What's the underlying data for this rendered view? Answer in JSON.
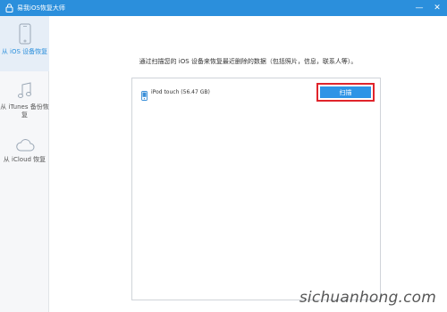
{
  "window": {
    "title": "易我iOS恢复大师",
    "controls": {
      "minimize": "—",
      "close": "✕"
    }
  },
  "sidebar": {
    "items": [
      {
        "label": "从 iOS 设备恢复",
        "icon": "phone-icon",
        "active": true
      },
      {
        "label": "从 iTunes 备份恢复",
        "icon": "music-note-icon",
        "active": false
      },
      {
        "label": "从 iCloud 恢复",
        "icon": "cloud-icon",
        "active": false
      }
    ]
  },
  "main": {
    "instruction": "通过扫描您的 iOS 设备来恢复最近删除的数据（包括照片，信息，联系人等）。",
    "device": {
      "name": "iPod touch (56.47 GB)",
      "icon": "ipod-icon"
    },
    "scan_label": "扫描"
  },
  "watermark": "sichuanhong.com",
  "colors": {
    "titlebar": "#2b8fdc",
    "accent": "#2e94e6",
    "highlight_border": "#e0242b"
  }
}
